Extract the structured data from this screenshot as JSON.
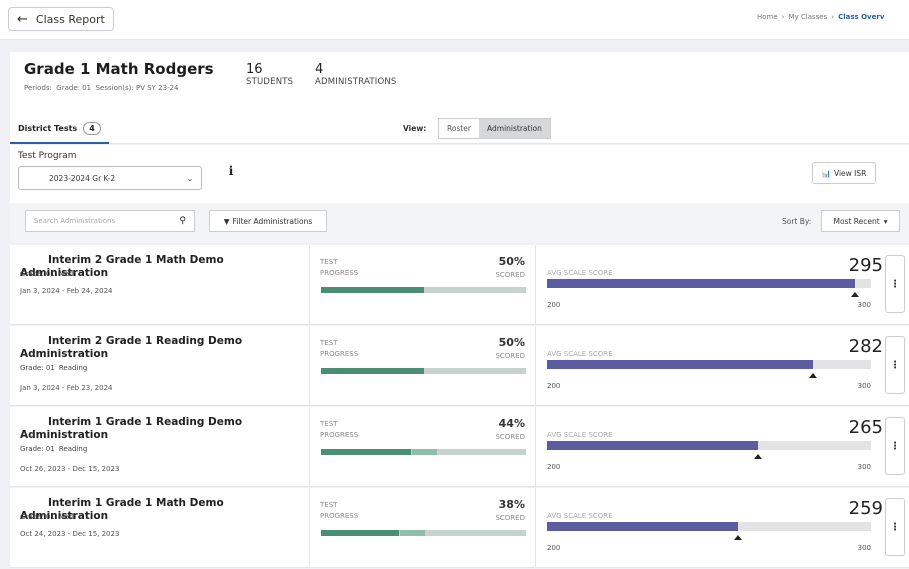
{
  "topbar": {
    "back_label": "Class Report",
    "breadcrumb": [
      "Home",
      "My Classes",
      "Class Overv"
    ]
  },
  "class_header": {
    "title": "Grade 1 Math Rodgers",
    "periods_label": "Periods:",
    "grade": "Grade: 01",
    "sessions": "Session(s): PV SY 23-24",
    "students_count": "16",
    "students_label": "STUDENTS",
    "administrations_count": "4",
    "administrations_label": "ADMINISTRATIONS"
  },
  "tabs": {
    "district_tests_label": "District Tests",
    "district_tests_count": "4",
    "view_label": "View:",
    "view_options": [
      "Roster",
      "Administration"
    ],
    "view_selected": "Administration"
  },
  "test_program": {
    "label": "Test Program",
    "selected": "2023-2024 Gr K-2",
    "view_isr_label": "View ISR"
  },
  "toolbar": {
    "search_placeholder": "Search Administrations",
    "filter_label": "Filter Administrations",
    "sort_label": "Sort By:",
    "sort_selected": "Most Recent"
  },
  "labels": {
    "test_progress_1": "TEST",
    "test_progress_2": "PROGRESS",
    "scored": "SCORED",
    "avg_scale_score": "AVG SCALE SCORE"
  },
  "administrations": [
    {
      "name": "Interim 2 Grade 1 Math Demo Administration",
      "grade": "Grade: 01",
      "subject": "Math",
      "dates": "Jan 3, 2024 - Feb 24, 2024",
      "progress_pct": "50%",
      "progress_complete": 0.5,
      "progress_partial": 0.0,
      "avg_scale_score": "295",
      "scale_min": "200",
      "scale_max": "300",
      "score_fill": 0.95,
      "marker_pos": 0.95
    },
    {
      "name": "Interim 2 Grade 1 Reading Demo Administration",
      "grade": "Grade: 01",
      "subject": "Reading",
      "dates": "Jan 3, 2024 - Feb 23, 2024",
      "progress_pct": "50%",
      "progress_complete": 0.5,
      "progress_partial": 0.0,
      "avg_scale_score": "282",
      "scale_min": "200",
      "scale_max": "300",
      "score_fill": 0.82,
      "marker_pos": 0.82
    },
    {
      "name": "Interim 1 Grade 1 Reading Demo Administration",
      "grade": "Grade: 01",
      "subject": "Reading",
      "dates": "Oct 26, 2023 - Dec 15, 2023",
      "progress_pct": "44%",
      "progress_complete": 0.44,
      "progress_partial": 0.12,
      "avg_scale_score": "265",
      "scale_min": "200",
      "scale_max": "300",
      "score_fill": 0.65,
      "marker_pos": 0.65
    },
    {
      "name": "Interim 1 Grade 1 Math Demo Administration",
      "grade": "Grade: 01",
      "subject": "Math",
      "dates": "Oct 24, 2023 - Dec 15, 2023",
      "progress_pct": "38%",
      "progress_complete": 0.38,
      "progress_partial": 0.12,
      "avg_scale_score": "259",
      "scale_min": "200",
      "scale_max": "300",
      "score_fill": 0.59,
      "marker_pos": 0.59
    }
  ],
  "colors": {
    "accent": "#2a5ea8",
    "progress_complete": "#4a8f74",
    "progress_partial": "#8fbfa9",
    "progress_track": "#c6d2cd",
    "score_fill": "#5b5da0",
    "score_track": "#e3e3e6"
  }
}
